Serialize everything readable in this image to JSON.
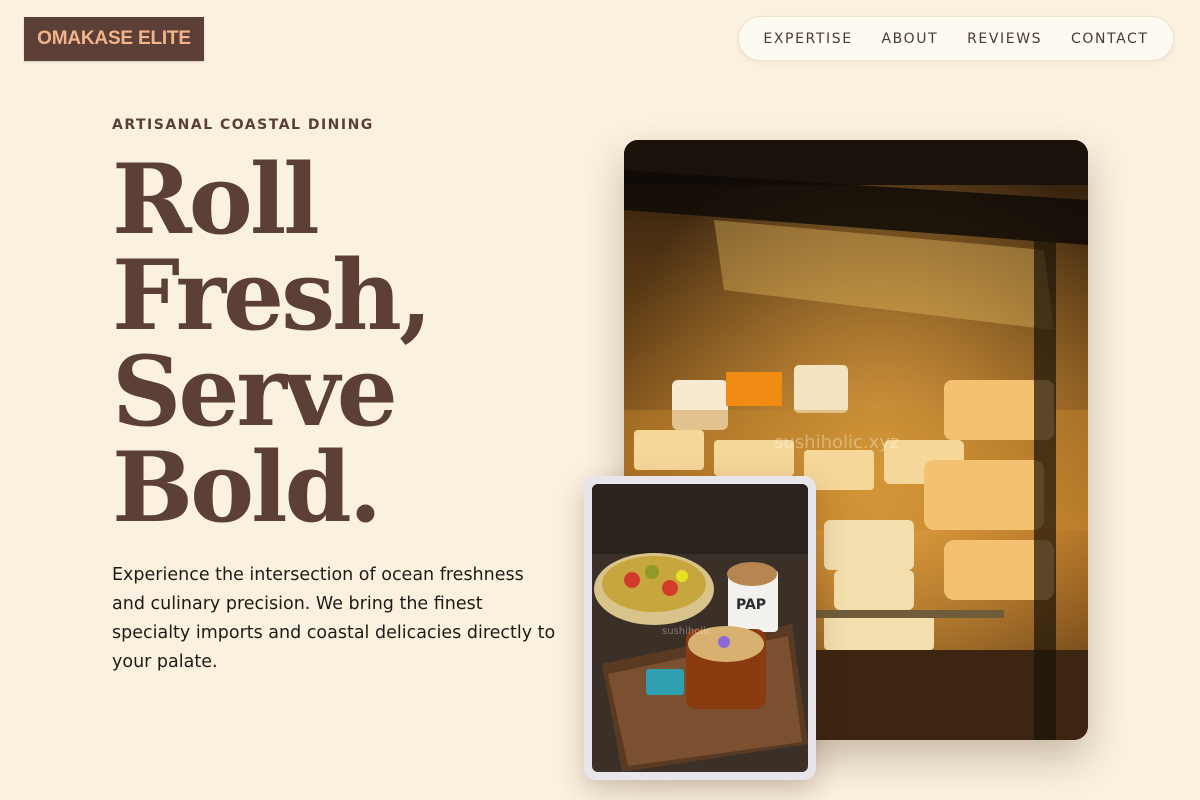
{
  "header": {
    "brand": "OMAKASE ELITE",
    "nav": [
      "EXPERTISE",
      "ABOUT",
      "REVIEWS",
      "CONTACT"
    ]
  },
  "hero": {
    "eyebrow": "ARTISANAL COASTAL DINING",
    "headline_lines": [
      "Roll",
      "Fresh,",
      "Serve",
      "Bold."
    ],
    "lede": "Experience the intersection of ocean freshness and culinary precision. We bring the finest specialty imports and coastal delicacies directly to your palate."
  },
  "images": {
    "main": {
      "subject": "cheese-display-case-photo",
      "watermark": "sushiholic.xyz"
    },
    "inset": {
      "subject": "food-and-drinks-tray-photo",
      "watermark": "sushiholic",
      "cup_text": "PAP"
    }
  },
  "colors": {
    "background": "#fbf1df",
    "brand_bg": "#5c3f36",
    "brand_text": "#f4b48a",
    "headline": "#5c3f36",
    "nav_bg": "#fdfaf1"
  }
}
